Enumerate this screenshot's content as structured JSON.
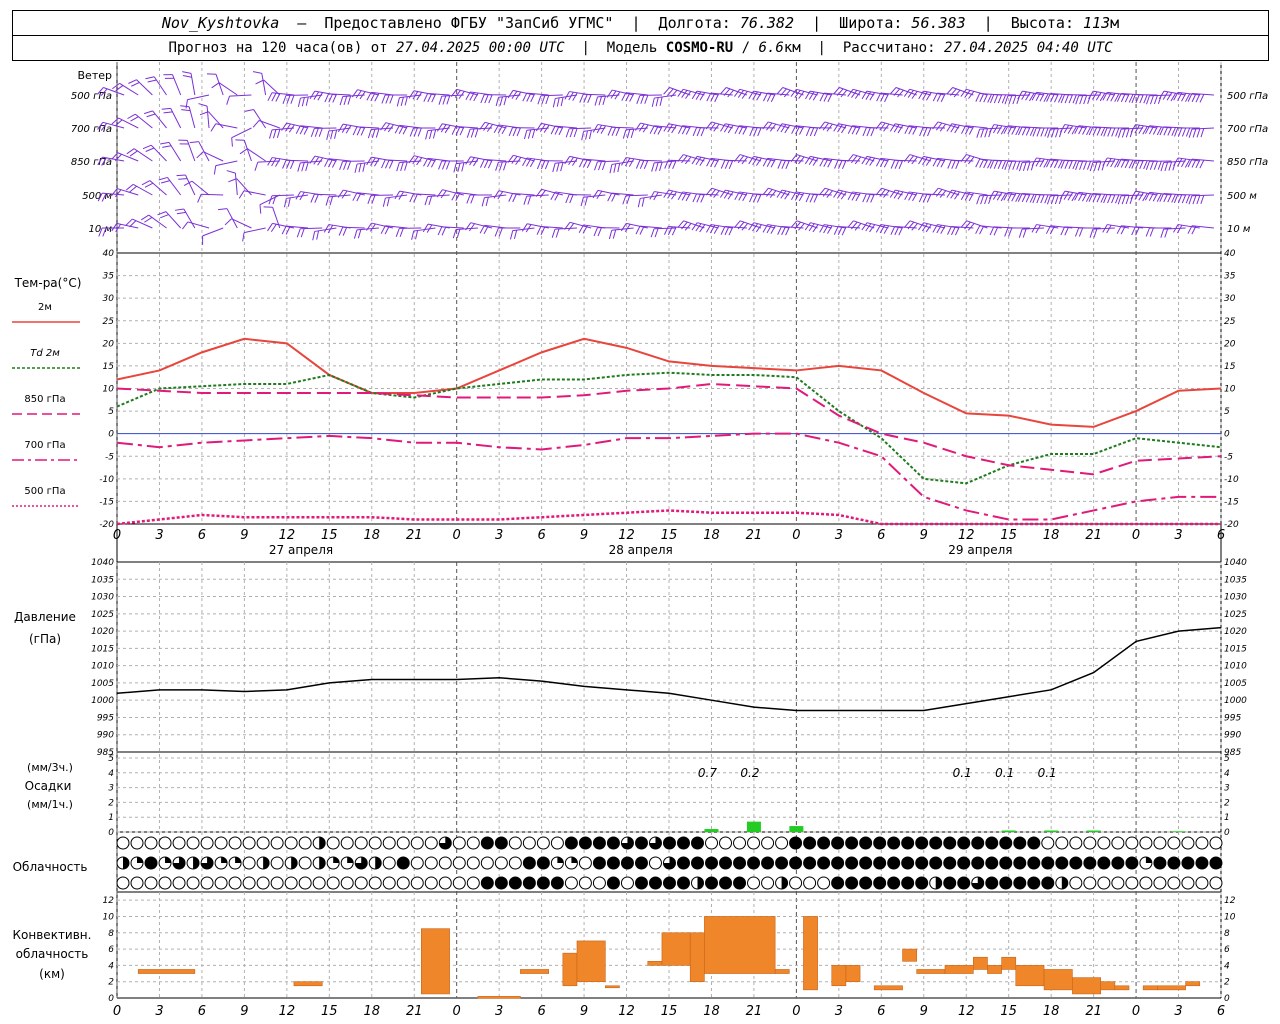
{
  "header": {
    "station": "Nov_Kyshtovka",
    "provider": "Предоставлено ФГБУ \"ЗапСиб УГМС\"",
    "lon_label": "Долгота:",
    "lon_value": "76.382",
    "lat_label": "Широта:",
    "lat_value": "56.383",
    "alt_label": "Высота:",
    "alt_value": "113",
    "alt_unit": "м",
    "forecast_label": "Прогноз на 120 часа(ов) от",
    "forecast_start": "27.04.2025 00:00 UTC",
    "model_label": "Модель",
    "model_name": "COSMO-RU",
    "model_res": "6.6",
    "model_res_unit": "км",
    "calc_label": "Рассчитано:",
    "calc_time": "27.04.2025 04:40 UTC"
  },
  "labels": {
    "wind": "Ветер",
    "wind_levels": [
      "500 гПа",
      "700 гПа",
      "850 гПа",
      "500 м",
      "10 м"
    ],
    "temp_title": "Тем-ра(°C)",
    "temp_legend": [
      "2м",
      "Td 2м",
      "850 гПа",
      "700 гПа",
      "500 гПа"
    ],
    "pressure_title": "Давление",
    "pressure_unit": "(гПа)",
    "precip_title_1": "(мм/3ч.)",
    "precip_title_2": "Осадки",
    "precip_title_3": "(мм/1ч.)",
    "cloud_title": "Облачность",
    "conv_title_1": "Конвективн.",
    "conv_title_2": "облачность",
    "conv_title_3": "(км)",
    "dates": [
      "27 апреля",
      "28 апреля",
      "29 апреля"
    ]
  },
  "colors": {
    "t2m": "#e8453c",
    "td2m": "#1e7b1e",
    "t850": "#e0197a",
    "t700": "#e0197a",
    "t500": "#e0197a",
    "wind": "#7b2fd6",
    "pressure": "#000000",
    "precip": "#22cc22",
    "conv": "#f0862a",
    "grid": "#b0b0b0"
  },
  "chart_data": [
    {
      "type": "line",
      "title": "Тем-ра(°C)",
      "x_hours": [
        0,
        3,
        6,
        9,
        12,
        15,
        18,
        21,
        24,
        27,
        30,
        33,
        36,
        39,
        42,
        45,
        48,
        51,
        54,
        57,
        60,
        63,
        66,
        69,
        72,
        75,
        78
      ],
      "x_ticks": [
        "0",
        "3",
        "6",
        "9",
        "12",
        "15",
        "18",
        "21",
        "0",
        "3",
        "6",
        "9",
        "12",
        "15",
        "18",
        "21",
        "0",
        "3",
        "6",
        "9",
        "12",
        "15",
        "18",
        "21",
        "0",
        "3",
        "6"
      ],
      "ylim": [
        -20,
        40
      ],
      "y_ticks": [
        -20,
        -15,
        -10,
        -5,
        0,
        5,
        10,
        15,
        20,
        25,
        30,
        35,
        40
      ],
      "series": [
        {
          "name": "2м",
          "style": "solid",
          "values": [
            12,
            14,
            18,
            21,
            20,
            13,
            9,
            9,
            10,
            14,
            18,
            21,
            19,
            16,
            15,
            14.5,
            14,
            15,
            14,
            9,
            4.5,
            4,
            2,
            1.5,
            5,
            9.5,
            10
          ]
        },
        {
          "name": "Td 2м",
          "style": "dotted",
          "values": [
            6,
            10,
            10.5,
            11,
            11,
            13,
            9,
            8,
            10,
            11,
            12,
            12,
            13,
            13.5,
            13,
            13,
            12.5,
            5,
            -1,
            -10,
            -11,
            -7,
            -4.5,
            -4.5,
            -1,
            -2,
            -3
          ]
        },
        {
          "name": "850 гПа",
          "style": "dash",
          "values": [
            10,
            9.5,
            9,
            9,
            9,
            9,
            9,
            8.5,
            8,
            8,
            8,
            8.5,
            9.5,
            10,
            11,
            10.5,
            10,
            4,
            0,
            -2,
            -5,
            -7,
            -8,
            -9,
            -6,
            -5.5,
            -5
          ]
        },
        {
          "name": "700 гПа",
          "style": "dashdot",
          "values": [
            -2,
            -3,
            -2,
            -1.5,
            -1,
            -0.5,
            -1,
            -2,
            -2,
            -3,
            -3.5,
            -2.5,
            -1,
            -1,
            -0.5,
            0,
            0,
            -2,
            -5,
            -14,
            -17,
            -19,
            -19,
            -17,
            -15,
            -14,
            -14
          ]
        },
        {
          "name": "500 гПа",
          "style": "dotted",
          "values": [
            -20,
            -19,
            -18,
            -18.5,
            -18.5,
            -18.5,
            -18.5,
            -19,
            -19,
            -19,
            -18.5,
            -18,
            -17.5,
            -17,
            -17.5,
            -17.5,
            -17.5,
            -18,
            -20,
            -20,
            -20,
            -20,
            -20,
            -20,
            -20,
            -20,
            -20
          ]
        }
      ]
    },
    {
      "type": "line",
      "title": "Давление (гПа)",
      "x_hours": [
        0,
        3,
        6,
        9,
        12,
        15,
        18,
        21,
        24,
        27,
        30,
        33,
        36,
        39,
        42,
        45,
        48,
        51,
        54,
        57,
        60,
        63,
        66,
        69,
        72,
        75,
        78
      ],
      "ylim": [
        985,
        1040
      ],
      "y_ticks": [
        985,
        990,
        995,
        1000,
        1005,
        1010,
        1015,
        1020,
        1025,
        1030,
        1035,
        1040
      ],
      "series": [
        {
          "name": "",
          "values": [
            1002,
            1003,
            1003,
            1002.5,
            1003,
            1005,
            1006,
            1006,
            1006,
            1006.5,
            1005.5,
            1004,
            1003,
            1002,
            1000,
            998,
            997,
            997,
            997,
            997,
            999,
            1001,
            1003,
            1008,
            1017,
            1020,
            1021
          ]
        }
      ]
    },
    {
      "type": "bar",
      "title": "Осадки",
      "ylim": [
        0,
        5
      ],
      "y_ticks": [
        0,
        1,
        2,
        3,
        4,
        5
      ],
      "x_hours": [
        42,
        45,
        48,
        51,
        54,
        57,
        60,
        63,
        66,
        69,
        72,
        75
      ],
      "values": [
        0.2,
        0.7,
        0.4,
        0,
        0,
        0,
        0,
        0.1,
        0.1,
        0.1,
        0,
        0.05
      ],
      "data_labels": [
        {
          "x_hour": 42,
          "text": "0.7"
        },
        {
          "x_hour": 45,
          "text": "0.2"
        },
        {
          "x_hour": 60,
          "text": "0.1"
        },
        {
          "x_hour": 63,
          "text": "0.1"
        },
        {
          "x_hour": 66,
          "text": "0.1"
        }
      ]
    },
    {
      "type": "table",
      "title": "Облачность",
      "rows": 3,
      "note": "cloud cover symbols per hour: 0=clear, 1=quarter, 2=half, 3=three-quarter, 4=overcast",
      "values": [
        "00000000000000200000000300440000444434344400000044444444444444444400000000000000000000000000",
        "21413231102020211320400000000441104444034444444444444444444444444444444441444441120000000000",
        "0000000000000000000000000044444400040444424440020004444444244344444200000000000004424444300000"
      ]
    },
    {
      "type": "bar",
      "title": "Конвективн. облачность (км)",
      "ylim": [
        0,
        13
      ],
      "y_ticks": [
        0,
        2,
        4,
        6,
        8,
        10,
        12
      ],
      "bars": [
        {
          "x0": 1.5,
          "x1": 5.5,
          "bottom": 3,
          "top": 3.5
        },
        {
          "x0": 12.5,
          "x1": 14.5,
          "bottom": 1.5,
          "top": 2
        },
        {
          "x0": 21.5,
          "x1": 23.5,
          "bottom": 0.5,
          "top": 8.5
        },
        {
          "x0": 25.5,
          "x1": 28.5,
          "bottom": 0,
          "top": 0.2
        },
        {
          "x0": 28.5,
          "x1": 30.5,
          "bottom": 3,
          "top": 3.5
        },
        {
          "x0": 31.5,
          "x1": 32.5,
          "bottom": 1.5,
          "top": 5.5
        },
        {
          "x0": 32.5,
          "x1": 34.5,
          "bottom": 2,
          "top": 7
        },
        {
          "x0": 34.5,
          "x1": 35.5,
          "bottom": 1.5,
          "top": 1.5
        },
        {
          "x0": 37.5,
          "x1": 38.5,
          "bottom": 4,
          "top": 4.5
        },
        {
          "x0": 38.5,
          "x1": 40.5,
          "bottom": 4,
          "top": 8
        },
        {
          "x0": 40.5,
          "x1": 41.5,
          "bottom": 2,
          "top": 8
        },
        {
          "x0": 41.5,
          "x1": 46.5,
          "bottom": 3,
          "top": 10
        },
        {
          "x0": 46.5,
          "x1": 47.5,
          "bottom": 3,
          "top": 3.5
        },
        {
          "x0": 48.5,
          "x1": 49.5,
          "bottom": 1,
          "top": 10
        },
        {
          "x0": 50.5,
          "x1": 51.5,
          "bottom": 1.5,
          "top": 4
        },
        {
          "x0": 51.5,
          "x1": 52.5,
          "bottom": 2,
          "top": 4
        },
        {
          "x0": 53.5,
          "x1": 55.5,
          "bottom": 1,
          "top": 1.5
        },
        {
          "x0": 55.5,
          "x1": 56.5,
          "bottom": 4.5,
          "top": 6
        },
        {
          "x0": 56.5,
          "x1": 58.5,
          "bottom": 3,
          "top": 3.5
        },
        {
          "x0": 58.5,
          "x1": 60.5,
          "bottom": 3,
          "top": 4
        },
        {
          "x0": 60.5,
          "x1": 61.5,
          "bottom": 3.5,
          "top": 5
        },
        {
          "x0": 61.5,
          "x1": 62.5,
          "bottom": 3,
          "top": 4
        },
        {
          "x0": 62.5,
          "x1": 63.5,
          "bottom": 3.5,
          "top": 5
        },
        {
          "x0": 63.5,
          "x1": 65.5,
          "bottom": 1.5,
          "top": 4
        },
        {
          "x0": 65.5,
          "x1": 67.5,
          "bottom": 1,
          "top": 3.5
        },
        {
          "x0": 67.5,
          "x1": 69.5,
          "bottom": 0.5,
          "top": 2.5
        },
        {
          "x0": 69.5,
          "x1": 70.5,
          "bottom": 1,
          "top": 2
        },
        {
          "x0": 70.5,
          "x1": 71.5,
          "bottom": 1,
          "top": 1.5
        },
        {
          "x0": 72.5,
          "x1": 73.5,
          "bottom": 1,
          "top": 1.5
        },
        {
          "x0": 73.5,
          "x1": 75.5,
          "bottom": 1,
          "top": 1.5
        },
        {
          "x0": 75.5,
          "x1": 76.5,
          "bottom": 1.5,
          "top": 2
        }
      ]
    }
  ]
}
